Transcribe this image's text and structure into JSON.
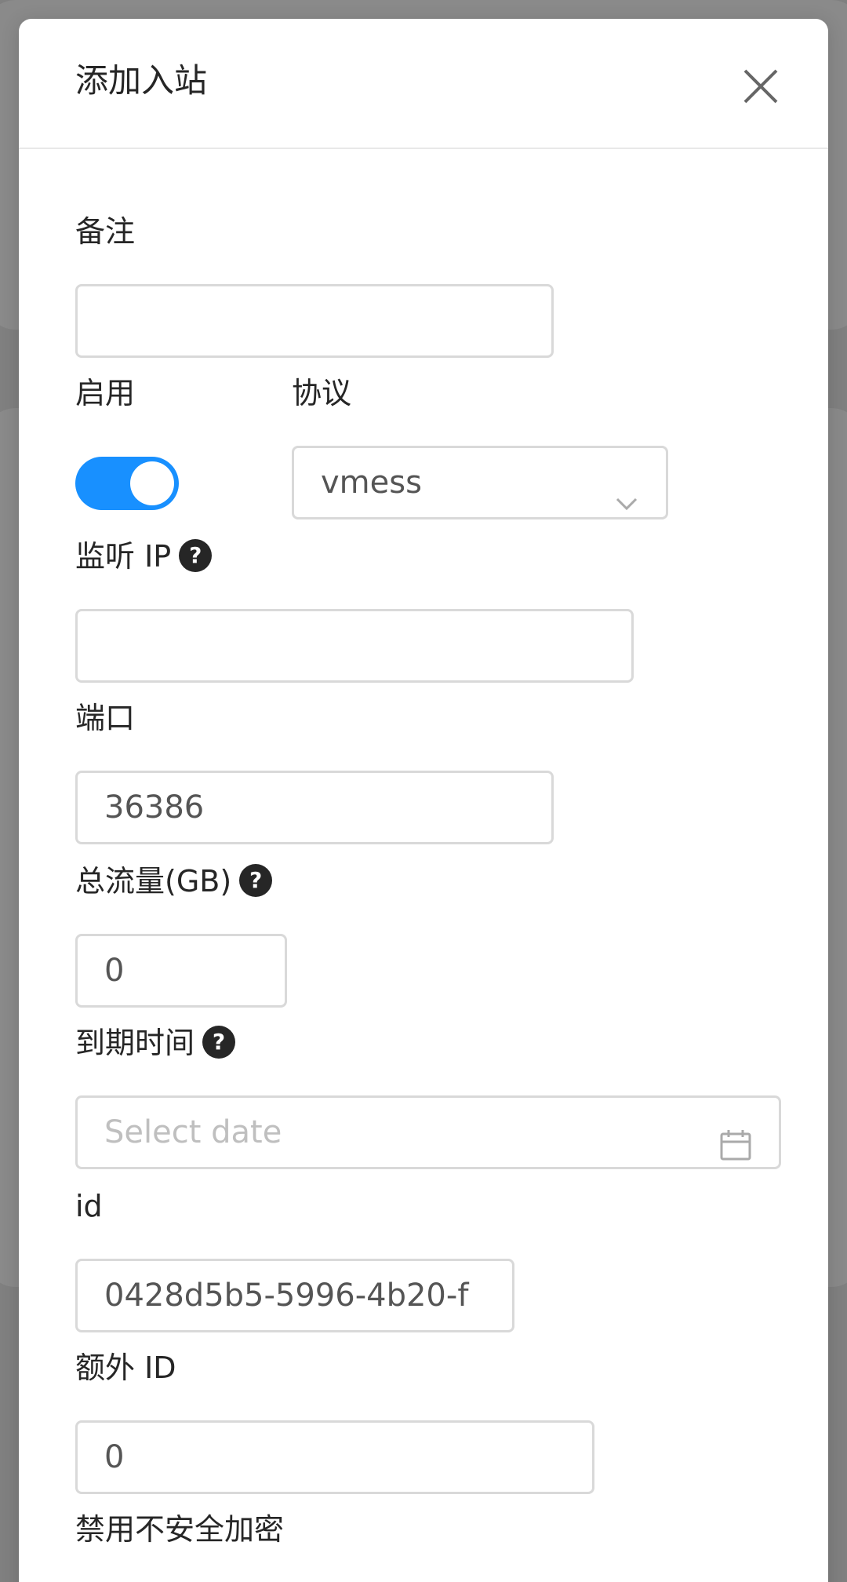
{
  "modal": {
    "title": "添加入站",
    "close_icon": "close-icon"
  },
  "form": {
    "remark": {
      "label": "备注",
      "value": ""
    },
    "enable": {
      "label": "启用",
      "checked": true
    },
    "protocol": {
      "label": "协议",
      "value": "vmess"
    },
    "listen_ip": {
      "label": "监听 IP",
      "value": ""
    },
    "port": {
      "label": "端口",
      "value": "36386"
    },
    "total_traffic": {
      "label": "总流量(GB)",
      "value": "0"
    },
    "expiry": {
      "label": "到期时间",
      "placeholder": "Select date"
    },
    "id": {
      "label": "id",
      "value": "0428d5b5-5996-4b20-f"
    },
    "alter_id": {
      "label": "额外 ID",
      "value": "0"
    },
    "disable_insecure": {
      "label": "禁用不安全加密"
    },
    "help_glyph": "?"
  },
  "colors": {
    "accent": "#1890ff",
    "overlay": "#808080",
    "border": "#d9d9d9",
    "text": "#262626"
  }
}
